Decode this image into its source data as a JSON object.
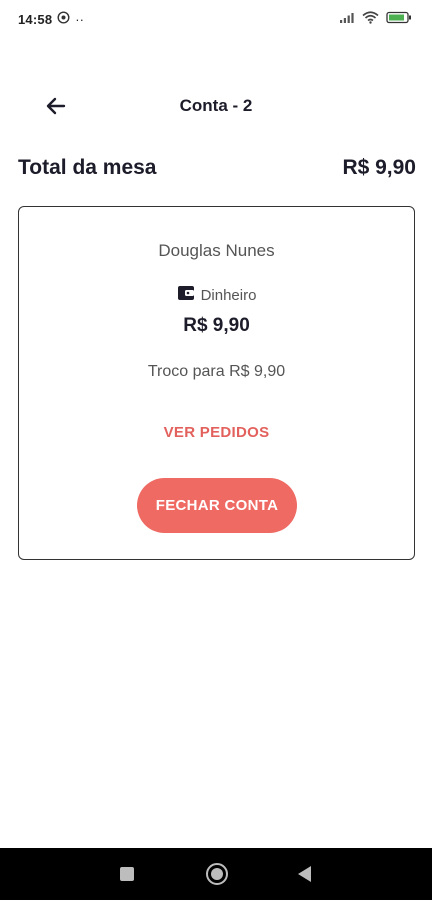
{
  "status_bar": {
    "time": "14:58",
    "notification_icon": "whatsapp-icon",
    "more_indicator": "··",
    "icons": [
      "signal-icon",
      "wifi-icon",
      "battery-icon"
    ]
  },
  "header": {
    "title": "Conta - 2",
    "back_icon": "arrow-left-icon"
  },
  "summary": {
    "total_label": "Total da mesa",
    "total_value": "R$ 9,90"
  },
  "card": {
    "customer_name": "Douglas Nunes",
    "payment_method": "Dinheiro",
    "payment_icon": "wallet-icon",
    "amount": "R$ 9,90",
    "change_text": "Troco para R$ 9,90",
    "view_orders_label": "VER PEDIDOS",
    "close_account_label": "FECHAR CONTA"
  },
  "colors": {
    "accent": "#ee6a63",
    "accent_text": "#e3615c",
    "text_primary": "#1c1c2a",
    "text_secondary": "#555555"
  },
  "nav_bar": {
    "icons": [
      "recents-icon",
      "home-icon",
      "back-icon"
    ]
  }
}
